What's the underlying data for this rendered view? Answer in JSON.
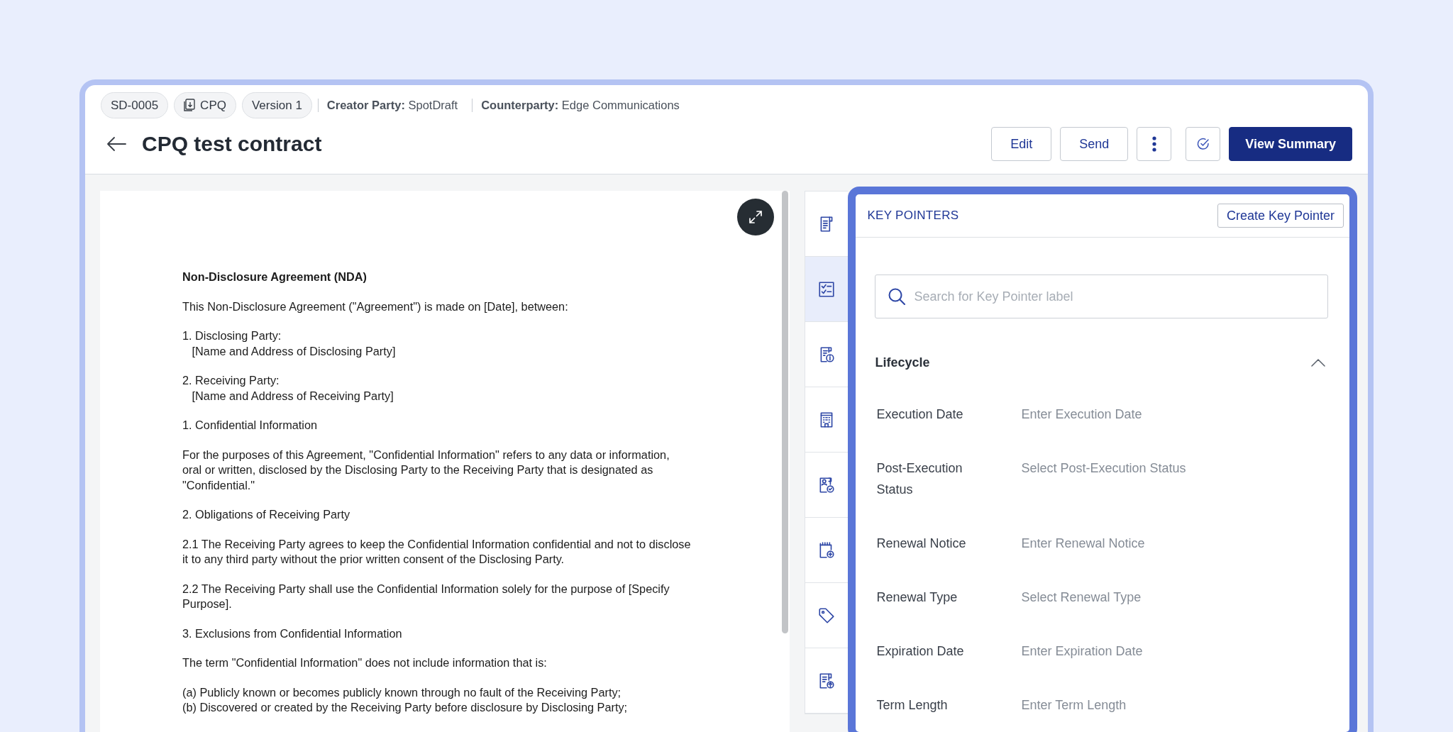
{
  "header": {
    "chips": [
      {
        "kind": "text",
        "label": "SD-0005"
      },
      {
        "kind": "icon",
        "label": "CPQ"
      },
      {
        "kind": "text",
        "label": "Version 1"
      }
    ],
    "parties": [
      "**Creator Party:** SpotDraft",
      "**Counterparty:** Edge Communications"
    ],
    "title": "CPQ test contract",
    "actions": [
      {
        "kind": "outline",
        "label": "Edit"
      },
      {
        "kind": "outline",
        "label": "Send"
      },
      {
        "kind": "more"
      },
      {
        "kind": "check"
      },
      {
        "kind": "primary",
        "label": "View Summary"
      }
    ]
  },
  "document": {
    "paragraphs": [
      {
        "kind": "heading",
        "text": "Non-Disclosure Agreement (NDA)"
      },
      {
        "kind": "body",
        "text": "This Non-Disclosure Agreement (\"Agreement\") is made on [Date], between:"
      },
      {
        "kind": "body",
        "text": "1. Disclosing Party:\n   [Name and Address of Disclosing Party]"
      },
      {
        "kind": "body",
        "text": "2. Receiving Party:\n   [Name and Address of Receiving Party]"
      },
      {
        "kind": "body",
        "text": "1. Confidential Information"
      },
      {
        "kind": "body",
        "text": "For the purposes of this Agreement, \"Confidential Information\" refers to any data or information,\noral or written, disclosed by the Disclosing Party to the Receiving Party that is designated as\n\"Confidential.\""
      },
      {
        "kind": "body",
        "text": "2. Obligations of Receiving Party"
      },
      {
        "kind": "body",
        "text": "2.1 The Receiving Party agrees to keep the Confidential Information confidential and not to disclose\nit to any third party without the prior written consent of the Disclosing Party."
      },
      {
        "kind": "body",
        "text": "2.2 The Receiving Party shall use the Confidential Information solely for the purpose of [Specify\nPurpose]."
      },
      {
        "kind": "body",
        "text": "3. Exclusions from Confidential Information"
      },
      {
        "kind": "body",
        "text": "The term \"Confidential Information\" does not include information that is:"
      },
      {
        "kind": "body",
        "text": "(a) Publicly known or becomes publicly known through no fault of the Receiving Party;\n(b) Discovered or created by the Receiving Party before disclosure by Disclosing Party;"
      }
    ]
  },
  "rail": [
    {
      "kind": "document",
      "selected": false
    },
    {
      "kind": "checklist",
      "selected": true
    },
    {
      "kind": "document-info",
      "selected": false
    },
    {
      "kind": "building",
      "selected": false
    },
    {
      "kind": "contact",
      "selected": false
    },
    {
      "kind": "calendar",
      "selected": false
    },
    {
      "kind": "tag",
      "selected": false
    },
    {
      "kind": "upload",
      "selected": false
    }
  ],
  "panel": {
    "title": "KEY POINTERS",
    "create_button": "Create Key Pointer",
    "search": {
      "placeholder": "Search for Key Pointer label"
    },
    "sections": [
      {
        "title": "Lifecycle",
        "expanded": true,
        "fields": [
          {
            "label": "Execution Date",
            "placeholder": "Enter Execution Date"
          },
          {
            "label": "Post-Execution Status",
            "placeholder": "Select Post-Execution Status"
          },
          {
            "label": "Renewal Notice",
            "placeholder": "Enter Renewal Notice"
          },
          {
            "label": "Renewal Type",
            "placeholder": "Select Renewal Type"
          },
          {
            "label": "Expiration Date",
            "placeholder": "Enter Expiration Date"
          },
          {
            "label": "Term Length",
            "placeholder": "Enter Term Length"
          }
        ]
      }
    ]
  }
}
